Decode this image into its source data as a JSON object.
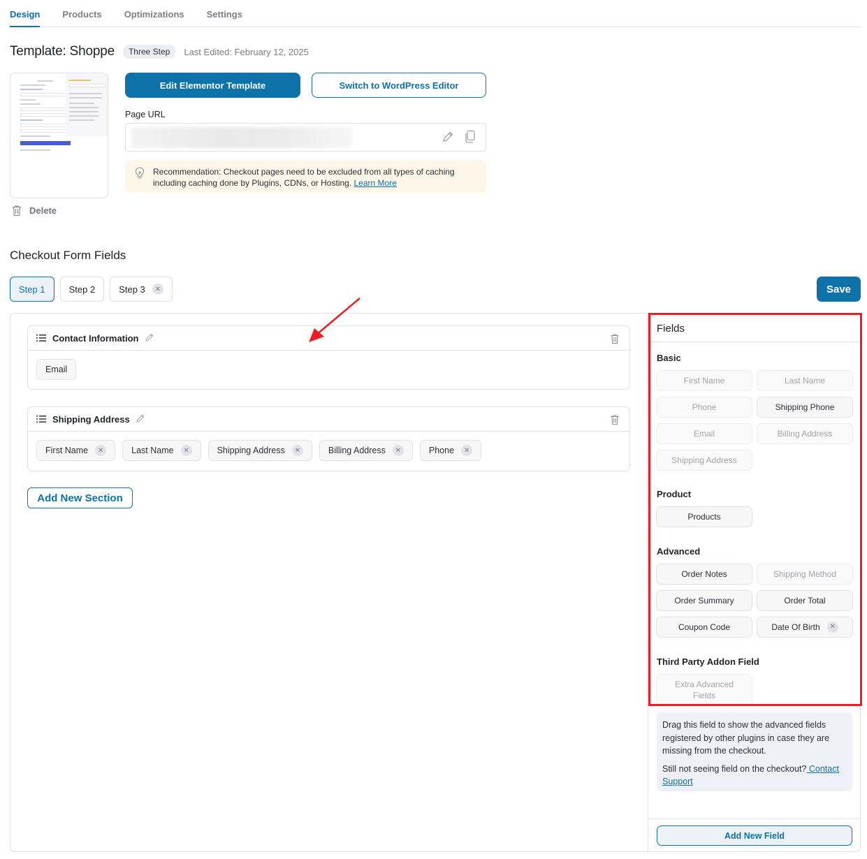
{
  "tabs": [
    {
      "label": "Design",
      "active": true
    },
    {
      "label": "Products",
      "active": false
    },
    {
      "label": "Optimizations",
      "active": false
    },
    {
      "label": "Settings",
      "active": false
    }
  ],
  "header": {
    "title": "Template: Shoppe",
    "badge": "Three Step",
    "last_edited": "Last Edited: February 12, 2025"
  },
  "template": {
    "delete_label": "Delete",
    "edit_button": "Edit Elementor Template",
    "switch_button": "Switch to WordPress Editor",
    "url_label": "Page URL",
    "recommendation": "Recommendation: Checkout pages need to be excluded from all types of caching including caching done by Plugins, CDNs, or Hosting.",
    "learn_more": "Learn More"
  },
  "checkout": {
    "title": "Checkout Form Fields",
    "steps": [
      {
        "label": "Step 1",
        "active": true,
        "removable": false
      },
      {
        "label": "Step 2",
        "active": false,
        "removable": false
      },
      {
        "label": "Step 3",
        "active": false,
        "removable": true
      }
    ],
    "save_label": "Save",
    "sections": [
      {
        "title": "Contact Information",
        "fields": [
          {
            "label": "Email",
            "removable": false
          }
        ]
      },
      {
        "title": "Shipping Address",
        "fields": [
          {
            "label": "First Name",
            "removable": true
          },
          {
            "label": "Last Name",
            "removable": true
          },
          {
            "label": "Shipping Address",
            "removable": true
          },
          {
            "label": "Billing Address",
            "removable": true
          },
          {
            "label": "Phone",
            "removable": true
          }
        ]
      }
    ],
    "add_section_label": "Add New Section"
  },
  "fields_panel": {
    "title": "Fields",
    "groups": [
      {
        "label": "Basic",
        "fields": [
          {
            "label": "First Name",
            "enabled": false
          },
          {
            "label": "Last Name",
            "enabled": false
          },
          {
            "label": "Phone",
            "enabled": false
          },
          {
            "label": "Shipping Phone",
            "enabled": true
          },
          {
            "label": "Email",
            "enabled": false
          },
          {
            "label": "Billing Address",
            "enabled": false
          },
          {
            "label": "Shipping Address",
            "enabled": false
          }
        ]
      },
      {
        "label": "Product",
        "fields": [
          {
            "label": "Products",
            "enabled": true
          }
        ]
      },
      {
        "label": "Advanced",
        "fields": [
          {
            "label": "Order Notes",
            "enabled": true
          },
          {
            "label": "Shipping Method",
            "enabled": false
          },
          {
            "label": "Order Summary",
            "enabled": true
          },
          {
            "label": "Order Total",
            "enabled": true
          },
          {
            "label": "Coupon Code",
            "enabled": true
          },
          {
            "label": "Date Of Birth",
            "enabled": true,
            "removable": true
          }
        ]
      },
      {
        "label": "Third Party Addon Field",
        "fields": [
          {
            "label": "Extra Advanced Fields",
            "enabled": false
          }
        ]
      }
    ],
    "info_text": "Drag this field to show the advanced fields registered by other plugins in case they are missing from the checkout.",
    "info_question": "Still not seeing field on the checkout?",
    "contact_support": " Contact Support",
    "add_field_label": "Add New Field"
  },
  "colors": {
    "accent": "#0c72a8",
    "highlight": "#ee1c24",
    "recommendation_bg": "#fdf6e9",
    "info_bg": "#eff0f7"
  }
}
